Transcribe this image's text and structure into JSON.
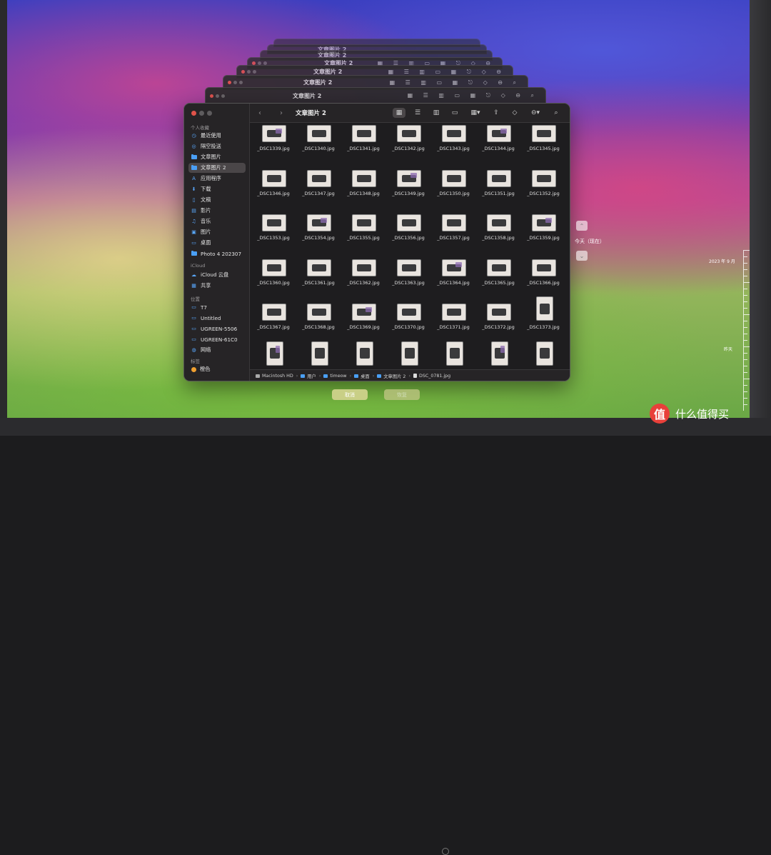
{
  "finder": {
    "title": "文章图片 2",
    "sidebar": {
      "favorites_header": "个人收藏",
      "favorites": [
        {
          "label": "最近使用",
          "icon": "clock-icon"
        },
        {
          "label": "隔空投送",
          "icon": "airdrop-icon"
        },
        {
          "label": "文章图片",
          "icon": "folder-icon"
        },
        {
          "label": "文章图片 2",
          "icon": "folder-icon",
          "active": true
        },
        {
          "label": "应用程序",
          "icon": "applications-icon"
        },
        {
          "label": "下载",
          "icon": "download-icon"
        },
        {
          "label": "文稿",
          "icon": "document-icon"
        },
        {
          "label": "影片",
          "icon": "movie-icon"
        },
        {
          "label": "音乐",
          "icon": "music-icon"
        },
        {
          "label": "图片",
          "icon": "picture-icon"
        },
        {
          "label": "桌面",
          "icon": "desktop-icon"
        },
        {
          "label": "Photo 4 202307",
          "icon": "folder-icon"
        }
      ],
      "icloud_header": "iCloud",
      "icloud": [
        {
          "label": "iCloud 云盘",
          "icon": "cloud-icon"
        },
        {
          "label": "共享",
          "icon": "shared-folder-icon"
        }
      ],
      "locations_header": "位置",
      "locations": [
        {
          "label": "T7",
          "icon": "drive-icon"
        },
        {
          "label": "Untitled",
          "icon": "drive-icon"
        },
        {
          "label": "UGREEN-5506",
          "icon": "server-icon"
        },
        {
          "label": "UGREEN-61C0",
          "icon": "server-icon"
        },
        {
          "label": "网络",
          "icon": "network-icon"
        }
      ],
      "tags_header": "标签",
      "tags": [
        {
          "label": "橙色",
          "color": "#f0a030"
        }
      ]
    },
    "files": [
      "_DSC1339.jpg",
      "_DSC1340.jpg",
      "_DSC1341.jpg",
      "_DSC1342.jpg",
      "_DSC1343.jpg",
      "_DSC1344.jpg",
      "_DSC1345.jpg",
      "_DSC1346.jpg",
      "_DSC1347.jpg",
      "_DSC1348.jpg",
      "_DSC1349.jpg",
      "_DSC1350.jpg",
      "_DSC1351.jpg",
      "_DSC1352.jpg",
      "_DSC1353.jpg",
      "_DSC1354.jpg",
      "_DSC1355.jpg",
      "_DSC1356.jpg",
      "_DSC1357.jpg",
      "_DSC1358.jpg",
      "_DSC1359.jpg",
      "_DSC1360.jpg",
      "_DSC1361.jpg",
      "_DSC1362.jpg",
      "_DSC1363.jpg",
      "_DSC1364.jpg",
      "_DSC1365.jpg",
      "_DSC1366.jpg",
      "_DSC1367.jpg",
      "_DSC1368.jpg",
      "_DSC1369.jpg",
      "_DSC1370.jpg",
      "_DSC1371.jpg",
      "_DSC1372.jpg",
      "_DSC1373.jpg"
    ],
    "path": [
      "Macintosh HD",
      "用户",
      "timeow",
      "桌面",
      "文章图片 2",
      "DSC_0781.jpg"
    ]
  },
  "time_machine": {
    "cancel_label": "取消",
    "restore_label": "恢复",
    "current_label": "今天（现在）",
    "timeline_labels": [
      "2023 年 9 月",
      "昨天"
    ]
  },
  "watermark": {
    "logo_char": "值",
    "text": "什么值得买"
  }
}
